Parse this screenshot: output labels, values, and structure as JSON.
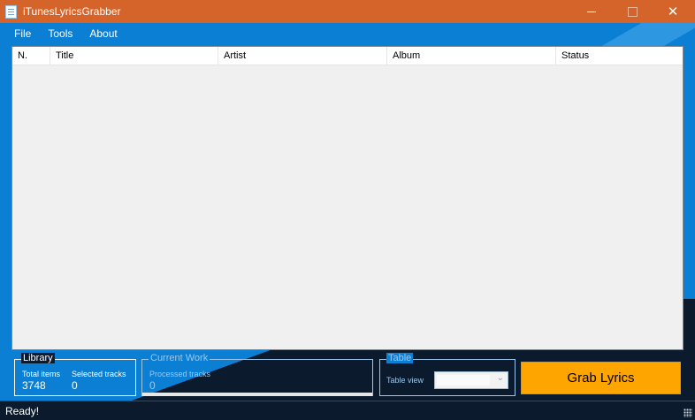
{
  "window": {
    "title": "iTunesLyricsGrabber"
  },
  "menu": {
    "items": [
      "File",
      "Tools",
      "About"
    ]
  },
  "table": {
    "columns": [
      "N.",
      "Title",
      "Artist",
      "Album",
      "Status"
    ],
    "rows": []
  },
  "library": {
    "title": "Library",
    "total_label": "Total items",
    "total_value": "3748",
    "selected_label": "Selected tracks",
    "selected_value": "0"
  },
  "current_work": {
    "title": "Current Work",
    "processed_label": "Processed tracks",
    "processed_value": "0",
    "progress": 0
  },
  "table_group": {
    "title": "Table",
    "view_label": "Table view",
    "view_value": ""
  },
  "grab_button": {
    "label": "Grab Lyrics"
  },
  "status": {
    "text": "Ready!"
  },
  "colors": {
    "titlebar": "#d4642a",
    "background": "#0a7fd4",
    "grab_button": "#ffa500",
    "statusbar": "#0b1a2d"
  }
}
